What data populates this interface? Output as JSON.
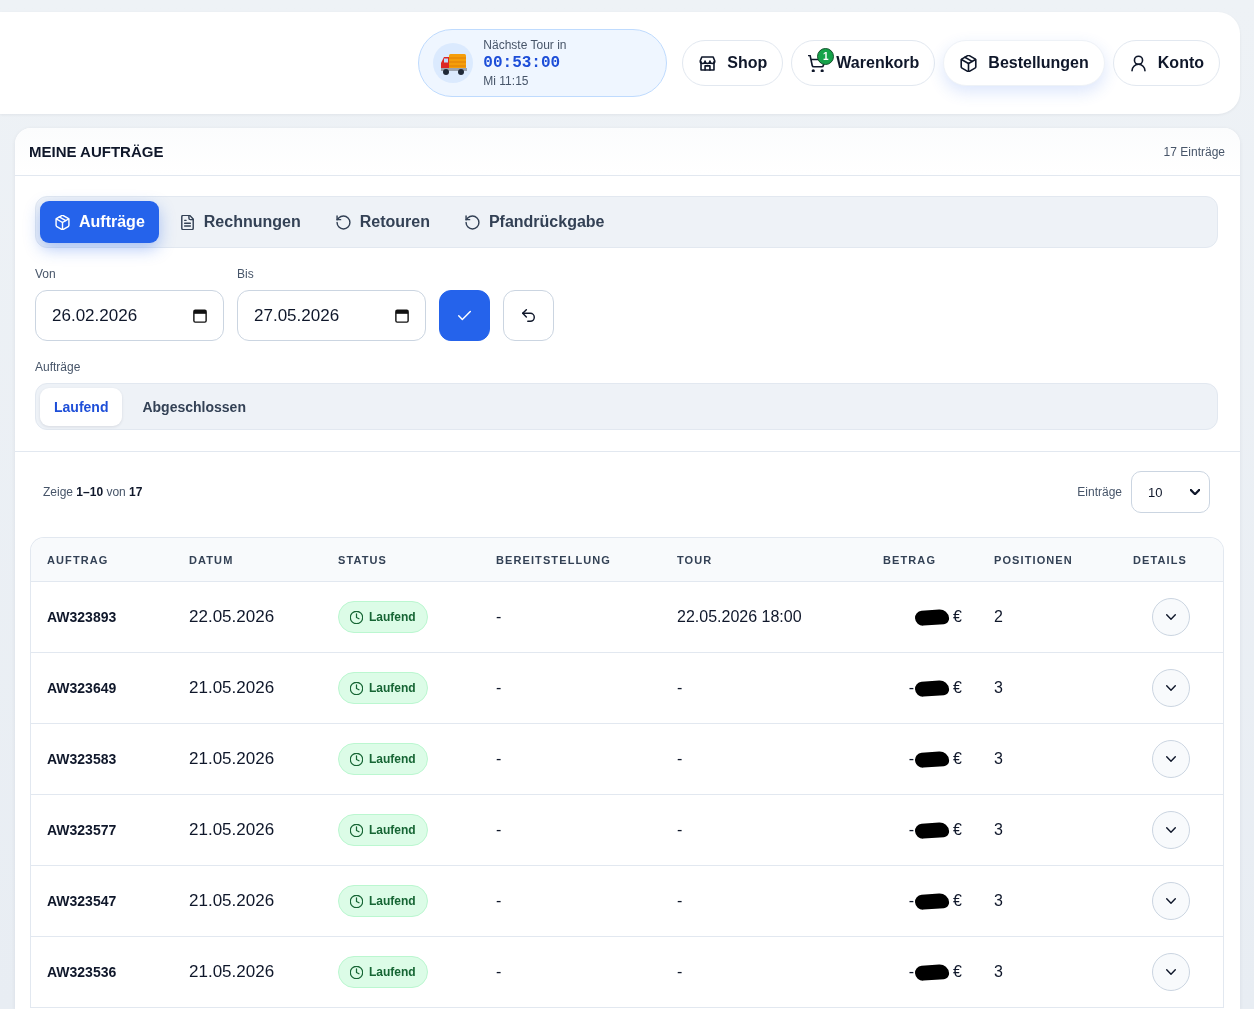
{
  "header": {
    "tour": {
      "label": "Nächste Tour in",
      "countdown": "00:53:00",
      "time": "Mi 11:15"
    },
    "nav": [
      {
        "kind": "shop",
        "label": "Shop",
        "selected": false
      },
      {
        "kind": "cart",
        "label": "Warenkorb",
        "badge": "1",
        "selected": false
      },
      {
        "kind": "orders",
        "label": "Bestellungen",
        "selected": true
      },
      {
        "kind": "account",
        "label": "Konto",
        "selected": false
      }
    ]
  },
  "panel": {
    "title": "MEINE AUFTRÄGE",
    "count": "17 Einträge",
    "tabs": [
      {
        "kind": "box",
        "label": "Aufträge",
        "selected": true
      },
      {
        "kind": "document",
        "label": "Rechnungen",
        "selected": false
      },
      {
        "kind": "rotate",
        "label": "Retouren",
        "selected": false
      },
      {
        "kind": "rotate",
        "label": "Pfandrückgabe",
        "selected": false
      }
    ],
    "date_filter": {
      "from": {
        "label": "Von",
        "value": "26.02.2026"
      },
      "to": {
        "label": "Bis",
        "value": "27.05.2026"
      }
    },
    "order_filter": {
      "label": "Aufträge",
      "options": [
        {
          "label": "Laufend",
          "selected": true
        },
        {
          "label": "Abgeschlossen",
          "selected": false
        }
      ]
    },
    "summary": "Zeige **1–10** von **17**",
    "page_size": {
      "label": "Einträge",
      "value": "10"
    },
    "table": {
      "columns": [
        "AUFTRAG",
        "DATUM",
        "STATUS",
        "BEREITSTELLUNG",
        "TOUR",
        "BETRAG",
        "POSITIONEN",
        "DETAILS"
      ],
      "rows": [
        {
          "auftrag": "AW323893",
          "datum": "22.05.2026",
          "status": "Laufend",
          "bereitstellung": "-",
          "tour": "22.05.2026 18:00",
          "betrag": {
            "currency": "€",
            "redacted": true
          },
          "positionen": "2",
          "expanded": false
        },
        {
          "auftrag": "AW323649",
          "datum": "21.05.2026",
          "status": "Laufend",
          "bereitstellung": "-",
          "tour": "-",
          "betrag": {
            "sign": "-",
            "currency": "€",
            "redacted": true
          },
          "positionen": "3",
          "expanded": false
        },
        {
          "auftrag": "AW323583",
          "datum": "21.05.2026",
          "status": "Laufend",
          "bereitstellung": "-",
          "tour": "-",
          "betrag": {
            "sign": "-",
            "currency": "€",
            "redacted": true
          },
          "positionen": "3",
          "expanded": false
        },
        {
          "auftrag": "AW323577",
          "datum": "21.05.2026",
          "status": "Laufend",
          "bereitstellung": "-",
          "tour": "-",
          "betrag": {
            "sign": "-",
            "currency": "€",
            "redacted": true
          },
          "positionen": "3",
          "expanded": false
        },
        {
          "auftrag": "AW323547",
          "datum": "21.05.2026",
          "status": "Laufend",
          "bereitstellung": "-",
          "tour": "-",
          "betrag": {
            "sign": "-",
            "currency": "€",
            "redacted": true
          },
          "positionen": "3",
          "expanded": false
        },
        {
          "auftrag": "AW323536",
          "datum": "21.05.2026",
          "status": "Laufend",
          "bereitstellung": "-",
          "tour": "-",
          "betrag": {
            "sign": "-",
            "currency": "€",
            "redacted": true
          },
          "positionen": "3",
          "expanded": false
        }
      ]
    }
  }
}
